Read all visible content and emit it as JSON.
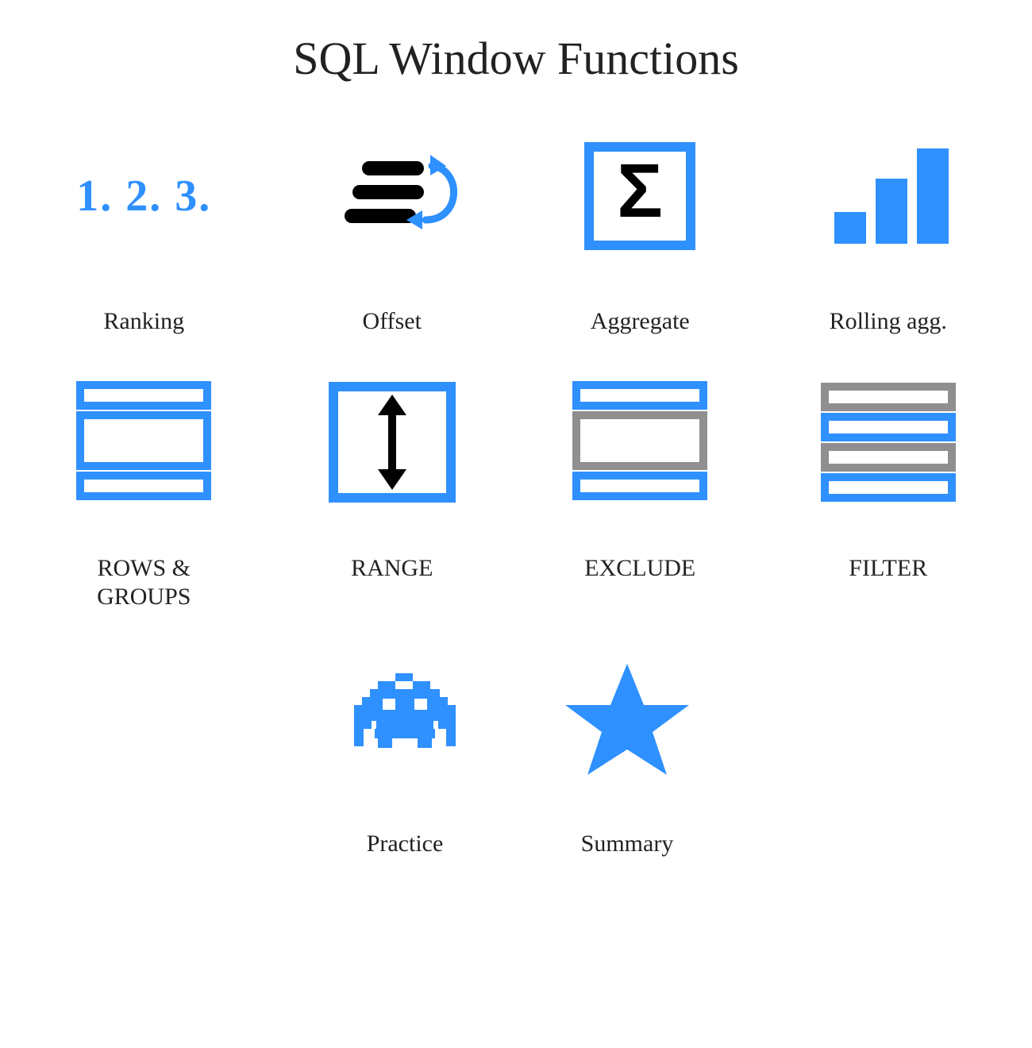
{
  "title": "SQL Window Functions",
  "colors": {
    "blue": "#2f90ff",
    "gray": "#8f8f8f",
    "black": "#000"
  },
  "tiles": {
    "ranking": {
      "label": "Ranking",
      "glyph": "1. 2. 3."
    },
    "offset": {
      "label": "Offset"
    },
    "aggregate": {
      "label": "Aggregate"
    },
    "rolling": {
      "label": "Rolling agg."
    },
    "rows": {
      "label": "ROWS &\nGROUPS"
    },
    "range": {
      "label": "RANGE"
    },
    "exclude": {
      "label": "EXCLUDE"
    },
    "filter": {
      "label": "FILTER"
    },
    "practice": {
      "label": "Practice"
    },
    "summary": {
      "label": "Summary"
    }
  }
}
